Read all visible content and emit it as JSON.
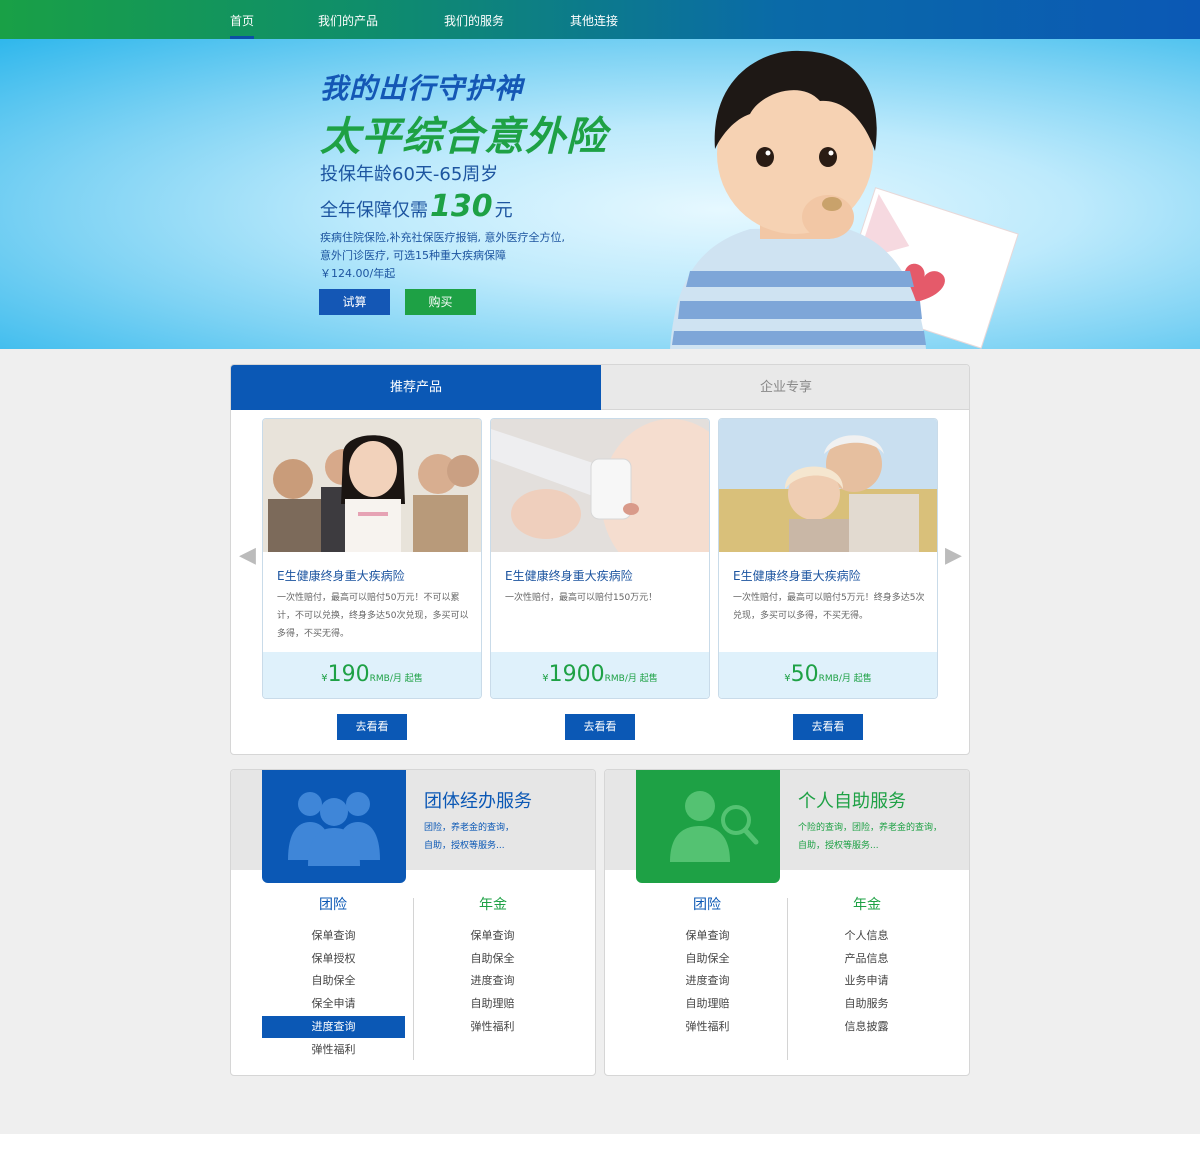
{
  "nav": {
    "items": [
      "首页",
      "我们的产品",
      "我们的服务",
      "其他连接"
    ]
  },
  "banner": {
    "title1": "我的出行守护神",
    "title2": "太平综合意外险",
    "line1": "投保年龄60天-65周岁",
    "line2_pre": "全年保障仅需",
    "line2_price": "130",
    "line2_post": "元",
    "desc1": "疾病住院保险,补充社保医疗报销, 意外医疗全方位,",
    "desc2": "意外门诊医疗, 可选15种重大疾病保障",
    "desc3": "￥124.00/年起",
    "btn_calc": "试算",
    "btn_buy": "购买"
  },
  "tabs": [
    "推荐产品",
    "企业专享"
  ],
  "cards": [
    {
      "title": "E生健康终身重大疾病险",
      "desc": "一次性赔付，最高可以赔付50万元！不可以累计，不可以兑换，终身多达50次兑现，多买可以多得，不买无得。",
      "yen": "¥",
      "price": "190",
      "unit": "RMB/月 起售",
      "button": "去看看"
    },
    {
      "title": "E生健康终身重大疾病险",
      "desc": "一次性赔付，最高可以赔付150万元！",
      "yen": "¥",
      "price": "1900",
      "unit": "RMB/月 起售",
      "button": "去看看"
    },
    {
      "title": "E生健康终身重大疾病险",
      "desc": "一次性赔付，最高可以赔付5万元！终身多达5次兑现，多买可以多得，不买无得。",
      "yen": "¥",
      "price": "50",
      "unit": "RMB/月 起售",
      "button": "去看看"
    }
  ],
  "group_service": {
    "title": "团体经办服务",
    "sub1": "团险，养老金的查询，",
    "sub2": "自助，授权等服务...",
    "col1_title": "团险",
    "col1": [
      "保单查询",
      "保单授权",
      "自助保全",
      "保全申请",
      "进度查询",
      "弹性福利"
    ],
    "col2_title": "年金",
    "col2": [
      "保单查询",
      "自助保全",
      "进度查询",
      "自助理赔",
      "弹性福利"
    ]
  },
  "personal_service": {
    "title": "个人自助服务",
    "sub1": "个险的查询，团险，养老金的查询，",
    "sub2": "自助，授权等服务...",
    "col1_title": "团险",
    "col1": [
      "保单查询",
      "自助保全",
      "进度查询",
      "自助理赔",
      "弹性福利"
    ],
    "col2_title": "年金",
    "col2": [
      "个人信息",
      "产品信息",
      "业务申请",
      "自助服务",
      "信息披露"
    ]
  },
  "colors": {
    "blue": "#0b58b5",
    "green": "#1ea145",
    "light_blue_bg": "#dff1fb"
  }
}
